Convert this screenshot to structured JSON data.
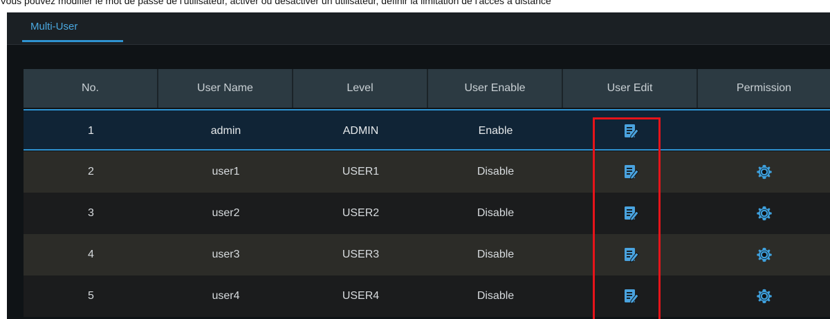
{
  "caption": "Vous pouvez modifier le mot de passe de l'utilisateur, activer ou désactiver un utilisateur, définir la limitation de l'accès à distance",
  "tab": {
    "label": "Multi-User"
  },
  "table": {
    "headers": [
      "No.",
      "User Name",
      "Level",
      "User Enable",
      "User Edit",
      "Permission"
    ],
    "rows": [
      {
        "no": "1",
        "name": "admin",
        "level": "ADMIN",
        "enable": "Enable",
        "edit_icon": "edit-icon",
        "permission_icon": ""
      },
      {
        "no": "2",
        "name": "user1",
        "level": "USER1",
        "enable": "Disable",
        "edit_icon": "edit-icon",
        "permission_icon": "gear-icon"
      },
      {
        "no": "3",
        "name": "user2",
        "level": "USER2",
        "enable": "Disable",
        "edit_icon": "edit-icon",
        "permission_icon": "gear-icon"
      },
      {
        "no": "4",
        "name": "user3",
        "level": "USER3",
        "enable": "Disable",
        "edit_icon": "edit-icon",
        "permission_icon": "gear-icon"
      },
      {
        "no": "5",
        "name": "user4",
        "level": "USER4",
        "enable": "Disable",
        "edit_icon": "edit-icon",
        "permission_icon": "gear-icon"
      }
    ]
  },
  "colors": {
    "accent": "#2f93d1",
    "highlight_box": "#e6141a"
  }
}
